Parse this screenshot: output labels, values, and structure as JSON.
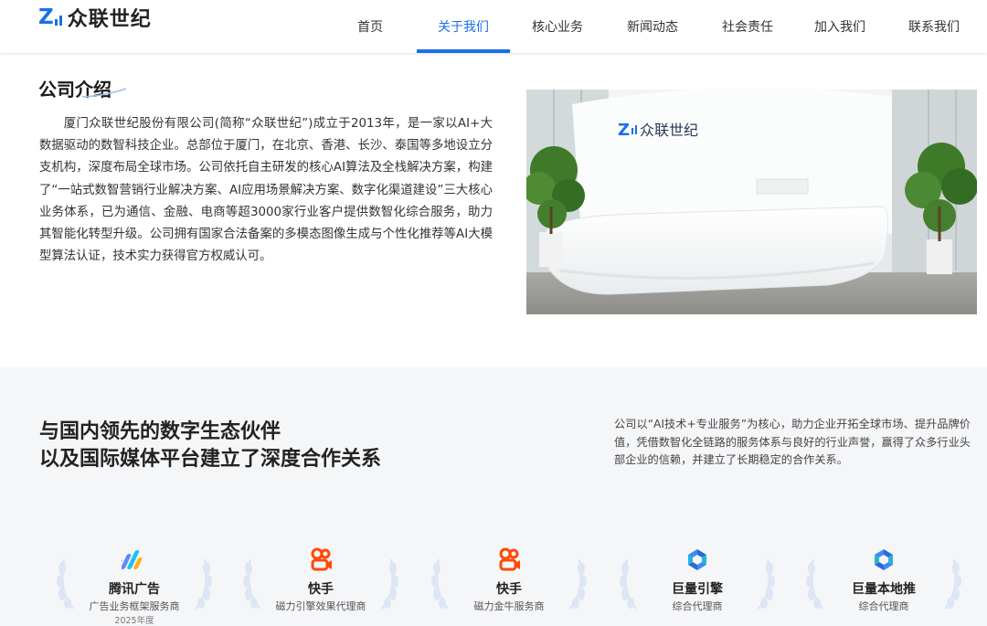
{
  "brand": {
    "name": "众联世纪",
    "logo_letter": "Z",
    "accent": "#1a6fe8"
  },
  "nav": {
    "items": [
      {
        "label": "首页",
        "active": false
      },
      {
        "label": "关于我们",
        "active": true
      },
      {
        "label": "核心业务",
        "active": false
      },
      {
        "label": "新闻动态",
        "active": false
      },
      {
        "label": "社会责任",
        "active": false
      },
      {
        "label": "加入我们",
        "active": false
      },
      {
        "label": "联系我们",
        "active": false
      }
    ]
  },
  "intro": {
    "title": "公司介绍",
    "body": "厦门众联世纪股份有限公司(简称“众联世纪”)成立于2013年，是一家以AI+大数据驱动的数智科技企业。总部位于厦门，在北京、香港、长沙、泰国等多地设立分支机构，深度布局全球市场。公司依托自主研发的核心AI算法及全栈解决方案，构建了“一站式数智营销行业解决方案、AI应用场景解决方案、数字化渠道建设”三大核心业务体系，已为通信、金融、电商等超3000家行业客户提供数智化综合服务，助力其智能化转型升级。公司拥有国家合法备案的多模态图像生成与个性化推荐等AI大模型算法认证，技术实力获得官方权威认可。",
    "photo_sign": "众联世纪"
  },
  "partners": {
    "title_line1": "与国内领先的数字生态伙伴",
    "title_line2": "以及国际媒体平台建立了深度合作关系",
    "description": "公司以“AI技术+专业服务”为核心，助力企业开拓全球市场、提升品牌价值，凭借数智化全链路的服务体系与良好的行业声誉，赢得了众多行业头部企业的信赖，并建立了长期稳定的合作关系。",
    "cards": [
      {
        "name": "腾讯广告",
        "sub": "广告业务框架服务商",
        "year": "2025年度",
        "icon": "tencent-ads-icon"
      },
      {
        "name": "快手",
        "sub": "磁力引擎效果代理商",
        "year": "",
        "icon": "kuaishou-icon"
      },
      {
        "name": "快手",
        "sub": "磁力金牛服务商",
        "year": "",
        "icon": "kuaishou-icon"
      },
      {
        "name": "巨量引擎",
        "sub": "综合代理商",
        "year": "",
        "icon": "ocean-engine-icon"
      },
      {
        "name": "巨量本地推",
        "sub": "综合代理商",
        "year": "",
        "icon": "ocean-engine-icon"
      }
    ]
  }
}
